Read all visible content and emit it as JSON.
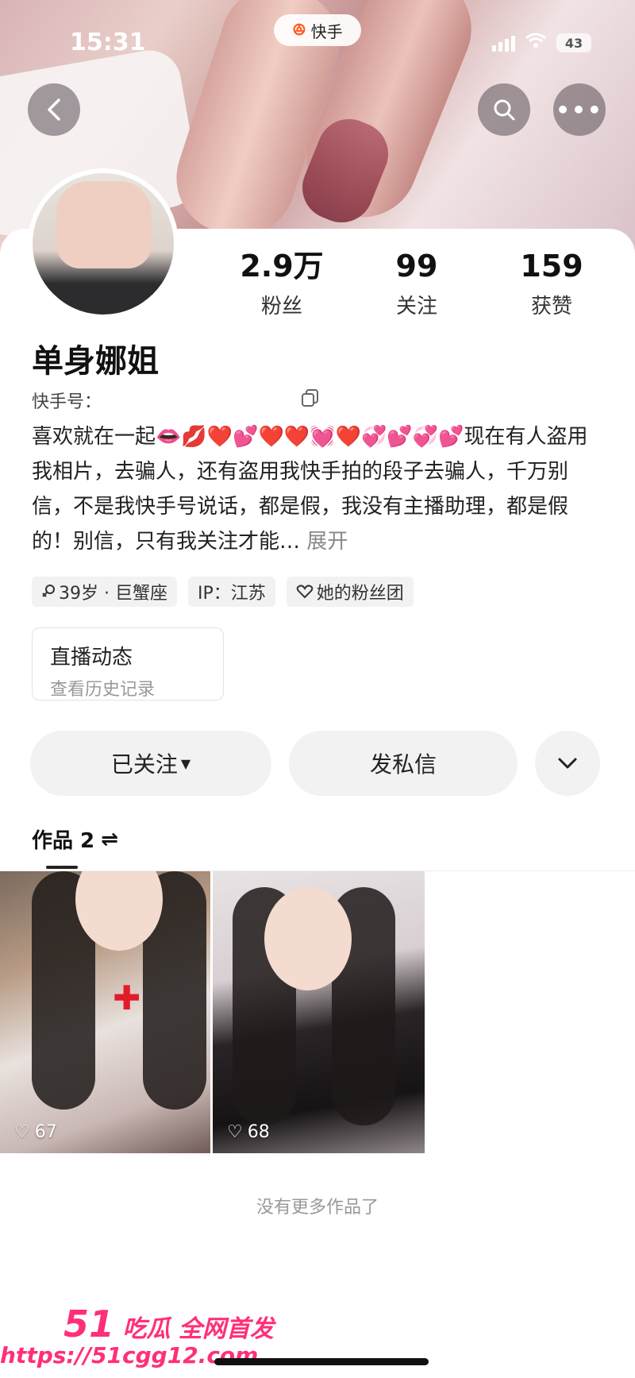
{
  "status_bar": {
    "time": "15:31",
    "app_name": "快手",
    "battery": "43"
  },
  "profile": {
    "name": "单身娜姐",
    "id_label": "快手号：",
    "stats": [
      {
        "value": "2.9万",
        "label": "粉丝"
      },
      {
        "value": "99",
        "label": "关注"
      },
      {
        "value": "159",
        "label": "获赞"
      }
    ],
    "bio": "喜欢就在一起👄💋❤️💕❤️❤️💓❤️💞💕💞💕现在有人盗用我相片，去骗人，还有盗用我快手拍的段子去骗人，千万别信，不是我快手号说话，都是假，我没有主播助理，都是假的！别信，只有我关注才能…",
    "bio_expand": "展开",
    "tags": [
      "39岁 · 巨蟹座",
      "IP：江苏",
      "她的粉丝团"
    ]
  },
  "live_card": {
    "title": "直播动态",
    "subtitle": "查看历史记录"
  },
  "actions": {
    "followed": "已关注",
    "message": "发私信"
  },
  "works": {
    "tab_label": "作品 2",
    "items": [
      {
        "likes": "67"
      },
      {
        "likes": "68"
      }
    ],
    "end_text": "没有更多作品了"
  },
  "watermark": {
    "number": "51",
    "slogan": "吃瓜 全网首发",
    "url": "https://51cgg12.com"
  },
  "colors": {
    "accent": "#ff5a1f",
    "watermark": "#ff2f7a"
  }
}
